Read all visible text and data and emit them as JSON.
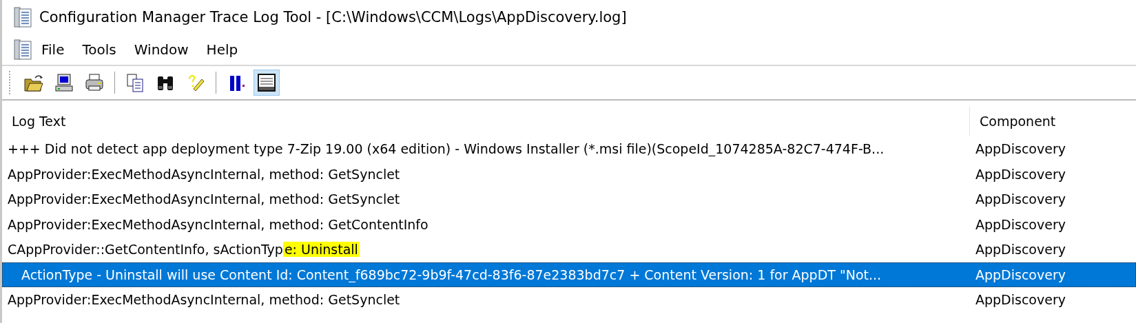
{
  "window": {
    "title": "Configuration Manager Trace Log Tool - [C:\\Windows\\CCM\\Logs\\AppDiscovery.log]"
  },
  "menu": [
    "File",
    "Tools",
    "Window",
    "Help"
  ],
  "toolbar": [
    {
      "kind": "open",
      "pressed": false
    },
    {
      "kind": "computer",
      "pressed": false
    },
    {
      "kind": "print",
      "pressed": false
    },
    {
      "kind": "separator"
    },
    {
      "kind": "copy",
      "pressed": false
    },
    {
      "kind": "find",
      "pressed": false
    },
    {
      "kind": "highlight",
      "pressed": false
    },
    {
      "kind": "separator"
    },
    {
      "kind": "pause",
      "pressed": false
    },
    {
      "kind": "logview",
      "pressed": true
    }
  ],
  "table": {
    "columns": [
      "Log Text",
      "Component"
    ],
    "rows": [
      {
        "log_text": [
          {
            "text": "+++ Did not detect app deployment type 7-Zip 19.00 (x64 edition) - Windows Installer (*.msi file)(ScopeId_1074285A-82C7-474F-B...",
            "highlighted": false
          }
        ],
        "component": "AppDiscovery",
        "selected": false
      },
      {
        "log_text": [
          {
            "text": "AppProvider:ExecMethodAsyncInternal, method: GetSynclet",
            "highlighted": false
          }
        ],
        "component": "AppDiscovery",
        "selected": false
      },
      {
        "log_text": [
          {
            "text": "AppProvider:ExecMethodAsyncInternal, method: GetSynclet",
            "highlighted": false
          }
        ],
        "component": "AppDiscovery",
        "selected": false
      },
      {
        "log_text": [
          {
            "text": "AppProvider:ExecMethodAsyncInternal, method: GetContentInfo",
            "highlighted": false
          }
        ],
        "component": "AppDiscovery",
        "selected": false
      },
      {
        "log_text": [
          {
            "text": "CAppProvider::GetContentInfo, sActionTyp",
            "highlighted": false
          },
          {
            "text": "e: Uninstall",
            "highlighted": true
          }
        ],
        "component": "AppDiscovery",
        "selected": false
      },
      {
        "log_text": [
          {
            "text": "ActionType - Uninstall will use Content Id: Content_f689bc72-9b9f-47cd-83f6-87e2383bd7c7 + Content Version: 1 for AppDT \"Not...",
            "highlighted": false
          }
        ],
        "component": "AppDiscovery",
        "selected": true
      },
      {
        "log_text": [
          {
            "text": "AppProvider:ExecMethodAsyncInternal, method: GetSynclet",
            "highlighted": false
          }
        ],
        "component": "AppDiscovery",
        "selected": false
      }
    ]
  }
}
